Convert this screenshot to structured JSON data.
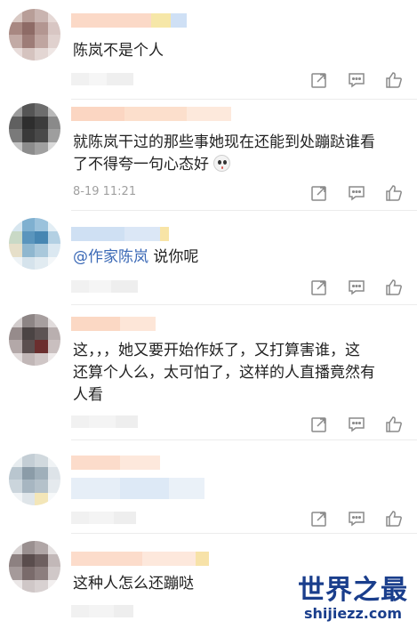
{
  "comments": [
    {
      "text": "陈岚不是个人",
      "timestamp": "",
      "actions": {
        "forward_icon": "forward-icon",
        "reply_icon": "comment-icon",
        "like_icon": "thumbs-up-icon"
      }
    },
    {
      "text_line1": "就陈岚干过的那些事她现在还能到处蹦跶谁看",
      "text_line2": "了不得夸一句心态好",
      "emoji_icon": "shocked-face-emoji",
      "timestamp": "8-19  11:21"
    },
    {
      "mention": "@作家陈岚",
      "text": " 说你呢"
    },
    {
      "text_line1": "这，，，她又要开始作妖了，又打算害谁，这",
      "text_line2": "还算个人么，太可怕了，这样的人直播竟然有",
      "text_line3": "人看"
    },
    {
      "text": ""
    },
    {
      "text": "这种人怎么还蹦哒"
    }
  ],
  "watermark": {
    "main": "世界之最",
    "sub": "shijiezz.com"
  },
  "colors": {
    "text": "#222222",
    "mention": "#3b69b6",
    "meta": "#a0a0a0",
    "icon": "#8a8a8a",
    "watermark": "#1a3e8c"
  }
}
